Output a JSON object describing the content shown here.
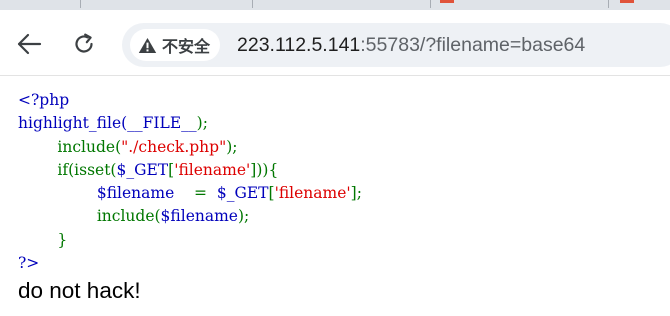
{
  "browser": {
    "security_label": "不安全",
    "url_host": "223.112.5.141",
    "url_rest": ":55783/?filename=base64",
    "icons": {
      "back": "back-arrow-icon",
      "reload": "reload-icon",
      "security": "warning-triangle-icon"
    }
  },
  "page": {
    "code": {
      "line1": {
        "open_tag": "<?php"
      },
      "line2": {
        "fn": "highlight_file(",
        "const": "__FILE__",
        "close": ");"
      },
      "line3": {
        "indent": "        ",
        "fn": "include(",
        "str": "\"./check.php\"",
        "close": ");"
      },
      "line4": {
        "indent": "        ",
        "kw": "if(isset(",
        "var": "$_GET",
        "br1": "[",
        "str": "'filename'",
        "br2": "])){"
      },
      "line5": {
        "indent": "                ",
        "var1": "$filename",
        "sp": "    ",
        "op": "=",
        "sp2": "  ",
        "var2": "$_GET",
        "br1": "[",
        "str": "'filename'",
        "br2": "];"
      },
      "line6": {
        "indent": "                ",
        "fn": "include(",
        "var": "$filename",
        "close": ");"
      },
      "line7": {
        "indent": "        ",
        "brace": "}"
      },
      "line8": {
        "close_tag": "?>"
      }
    },
    "output": "do not hack!"
  },
  "colors": {
    "php_default": "#0000BB",
    "php_keyword": "#007700",
    "php_string": "#DD0000",
    "tab_accent": "#E0533A"
  }
}
